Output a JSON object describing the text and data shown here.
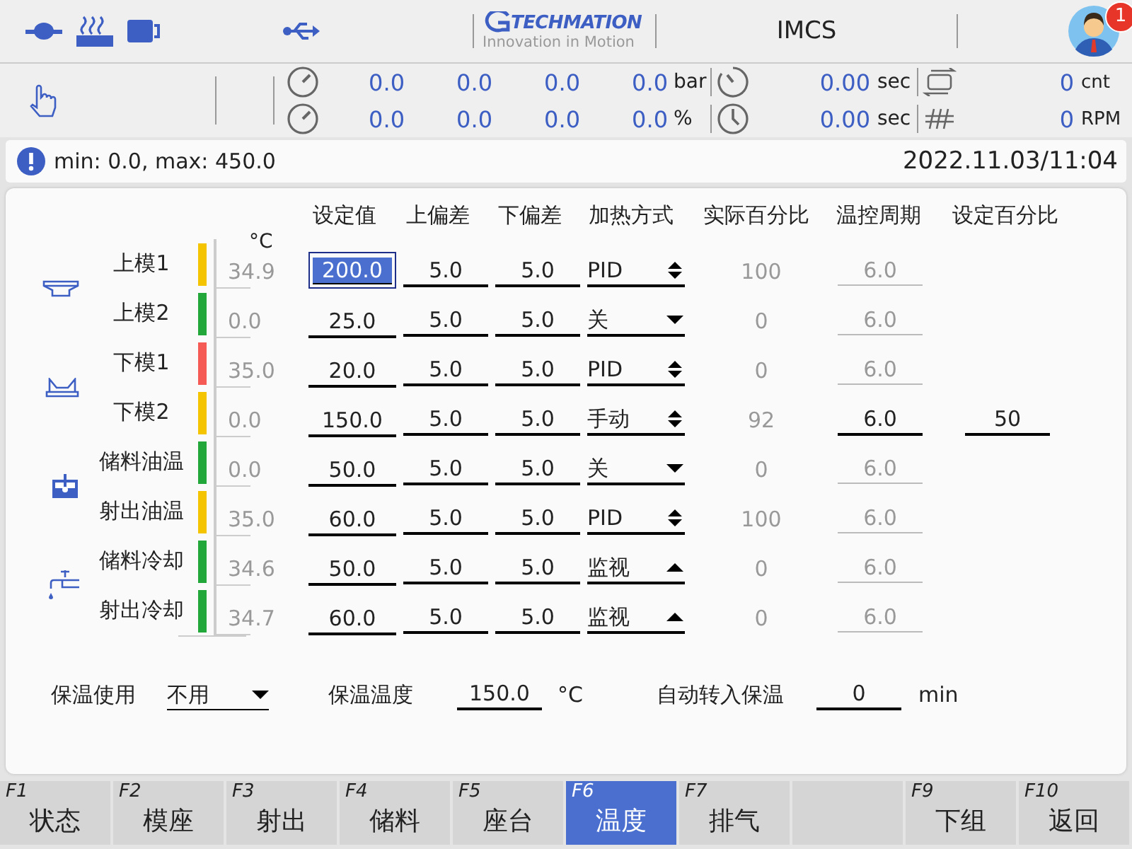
{
  "header": {
    "logo_title": "TECHMATION",
    "logo_slogan": "Innovation in Motion",
    "title": "IMCS",
    "badge": "1"
  },
  "readouts": [
    {
      "values": [
        "0.0",
        "0.0",
        "0.0",
        "0.0"
      ],
      "unit": "bar",
      "time": "0.00",
      "time_unit": "sec",
      "count": "0",
      "count_unit": "cnt"
    },
    {
      "values": [
        "0.0",
        "0.0",
        "0.0",
        "0.0"
      ],
      "unit": "%",
      "time": "0.00",
      "time_unit": "sec",
      "count": "0",
      "count_unit": "RPM"
    }
  ],
  "info": {
    "message": "min: 0.0, max: 450.0",
    "datetime": "2022.11.03/11:04"
  },
  "table": {
    "unit": "°C",
    "columns": [
      "设定值",
      "上偏差",
      "下偏差",
      "加热方式",
      "实际百分比",
      "温控周期",
      "设定百分比"
    ],
    "groups": [
      {
        "kind": "upper-mold",
        "zones": [
          {
            "name": "上模1",
            "color": "#f5c400",
            "temp": "34.9",
            "setpoint": "200.0",
            "selected": true,
            "upper": "5.0",
            "lower": "5.0",
            "mode": "PID",
            "kind": "updown",
            "actual": "100",
            "cycle": "6.0",
            "cycle_enabled": false
          },
          {
            "name": "上模2",
            "color": "#22a83a",
            "temp": "0.0",
            "setpoint": "25.0",
            "selected": false,
            "upper": "5.0",
            "lower": "5.0",
            "mode": "关",
            "kind": "down",
            "actual": "0",
            "cycle": "6.0",
            "cycle_enabled": false
          }
        ]
      },
      {
        "kind": "lower-mold",
        "zones": [
          {
            "name": "下模1",
            "color": "#f55a55",
            "temp": "35.0",
            "setpoint": "20.0",
            "selected": false,
            "upper": "5.0",
            "lower": "5.0",
            "mode": "PID",
            "kind": "updown",
            "actual": "0",
            "cycle": "6.0",
            "cycle_enabled": false
          },
          {
            "name": "下模2",
            "color": "#f5c400",
            "temp": "0.0",
            "setpoint": "150.0",
            "selected": false,
            "upper": "5.0",
            "lower": "5.0",
            "mode": "手动",
            "kind": "updown",
            "actual": "92",
            "cycle": "6.0",
            "cycle_enabled": true,
            "set_percent": "50"
          }
        ]
      },
      {
        "kind": "oil",
        "zones": [
          {
            "name": "储料油温",
            "color": "#22a83a",
            "temp": "0.0",
            "setpoint": "50.0",
            "selected": false,
            "upper": "5.0",
            "lower": "5.0",
            "mode": "关",
            "kind": "down",
            "actual": "0",
            "cycle": "6.0",
            "cycle_enabled": false
          },
          {
            "name": "射出油温",
            "color": "#f5c400",
            "temp": "35.0",
            "setpoint": "60.0",
            "selected": false,
            "upper": "5.0",
            "lower": "5.0",
            "mode": "PID",
            "kind": "updown",
            "actual": "100",
            "cycle": "6.0",
            "cycle_enabled": false
          }
        ]
      },
      {
        "kind": "cooling",
        "zones": [
          {
            "name": "储料冷却",
            "color": "#22a83a",
            "temp": "34.6",
            "setpoint": "50.0",
            "selected": false,
            "upper": "5.0",
            "lower": "5.0",
            "mode": "监视",
            "kind": "up",
            "actual": "0",
            "cycle": "6.0",
            "cycle_enabled": false
          },
          {
            "name": "射出冷却",
            "color": "#22a83a",
            "temp": "34.7",
            "setpoint": "60.0",
            "selected": false,
            "upper": "5.0",
            "lower": "5.0",
            "mode": "监视",
            "kind": "up",
            "actual": "0",
            "cycle": "6.0",
            "cycle_enabled": false
          }
        ]
      }
    ]
  },
  "hold": {
    "use_label": "保温使用",
    "use_value": "不用",
    "temp_label": "保温温度",
    "temp_value": "150.0",
    "temp_unit": "°C",
    "auto_label": "自动转入保温",
    "auto_value": "0",
    "auto_unit": "min"
  },
  "function_keys": [
    {
      "kind": "key",
      "key": "F1",
      "label": "状态",
      "selected": false
    },
    {
      "kind": "key",
      "key": "F2",
      "label": "模座",
      "selected": false
    },
    {
      "kind": "key",
      "key": "F3",
      "label": "射出",
      "selected": false
    },
    {
      "kind": "key",
      "key": "F4",
      "label": "储料",
      "selected": false
    },
    {
      "kind": "key",
      "key": "F5",
      "label": "座台",
      "selected": false
    },
    {
      "kind": "key",
      "key": "F6",
      "label": "温度",
      "selected": true
    },
    {
      "kind": "key",
      "key": "F7",
      "label": "排气",
      "selected": false
    },
    {
      "kind": "blank"
    },
    {
      "kind": "key",
      "key": "F9",
      "label": "下组",
      "selected": false
    },
    {
      "kind": "key",
      "key": "F10",
      "label": "返回",
      "selected": false
    }
  ]
}
